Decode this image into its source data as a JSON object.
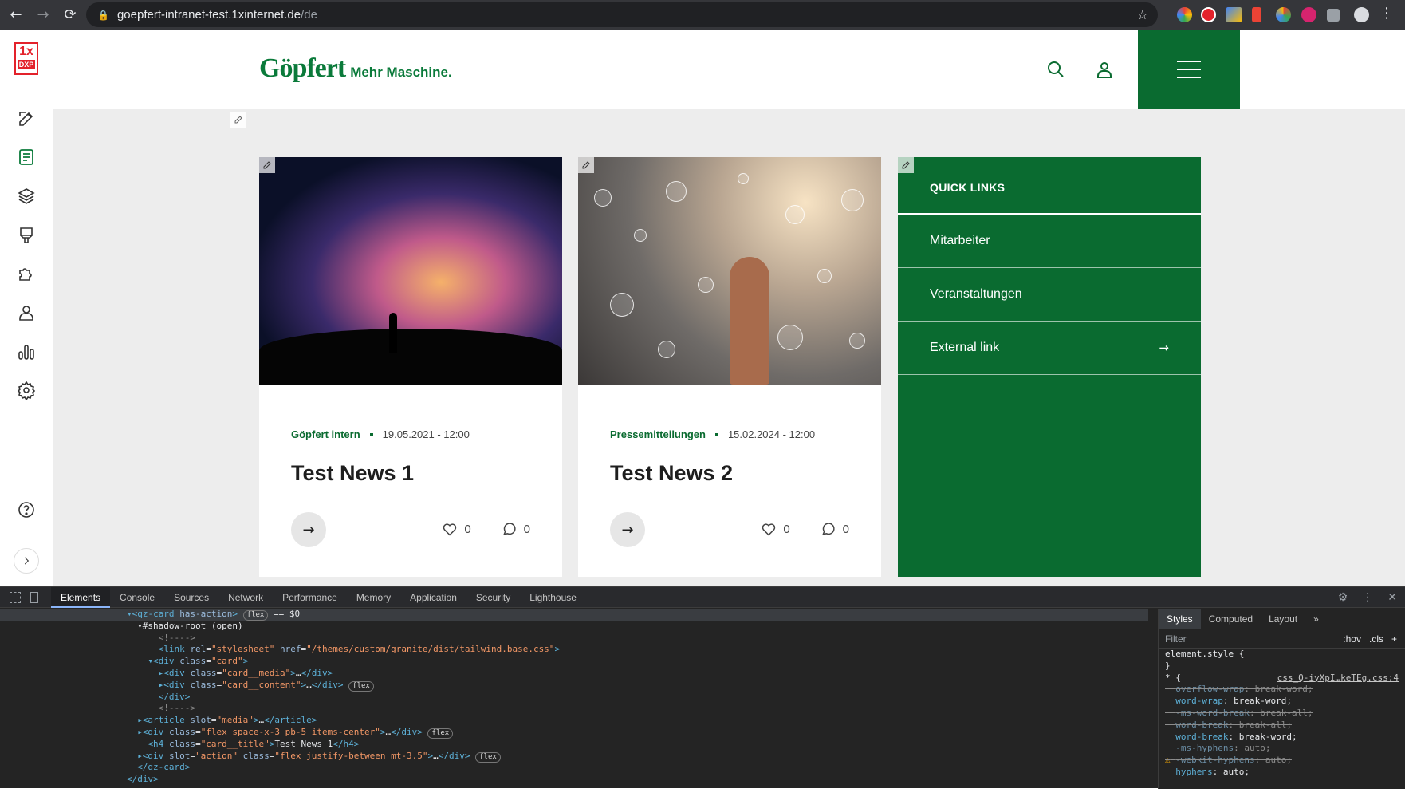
{
  "browser": {
    "url_host": "goepfert-intranet-test.1xinternet.de",
    "url_path": "/de"
  },
  "dxp": {
    "logo_top": "1x",
    "logo_bottom": "DXP",
    "icons": [
      "edit-icon",
      "content-icon",
      "layers-icon",
      "brush-icon",
      "extensions-icon",
      "user-icon",
      "analytics-icon",
      "settings-icon",
      "help-icon",
      "expand-icon"
    ]
  },
  "site": {
    "brand_name": "Göpfert",
    "brand_tagline": "Mehr Maschine.",
    "brand_color": "#0a6b30"
  },
  "cards": [
    {
      "category": "Göpfert intern",
      "date": "19.05.2021 - 12:00",
      "title": "Test News 1",
      "likes": "0",
      "comments": "0"
    },
    {
      "category": "Pressemitteilungen",
      "date": "15.02.2024 - 12:00",
      "title": "Test News 2",
      "likes": "0",
      "comments": "0"
    }
  ],
  "quick_links": {
    "title": "QUICK LINKS",
    "items": [
      {
        "label": "Mitarbeiter"
      },
      {
        "label": "Veranstaltungen"
      },
      {
        "label": "External link",
        "arrow": "→"
      }
    ]
  },
  "devtools": {
    "tabs": [
      "Elements",
      "Console",
      "Sources",
      "Network",
      "Performance",
      "Memory",
      "Application",
      "Security",
      "Lighthouse"
    ],
    "styles_tabs": [
      "Styles",
      "Computed",
      "Layout",
      "»"
    ],
    "filter_placeholder": "Filter",
    "hov": ":hov",
    "cls": ".cls",
    "element_style": "element.style {",
    "close_brace": "}",
    "source_link": "css_Q-iyXpI…keTEg.css:4"
  }
}
